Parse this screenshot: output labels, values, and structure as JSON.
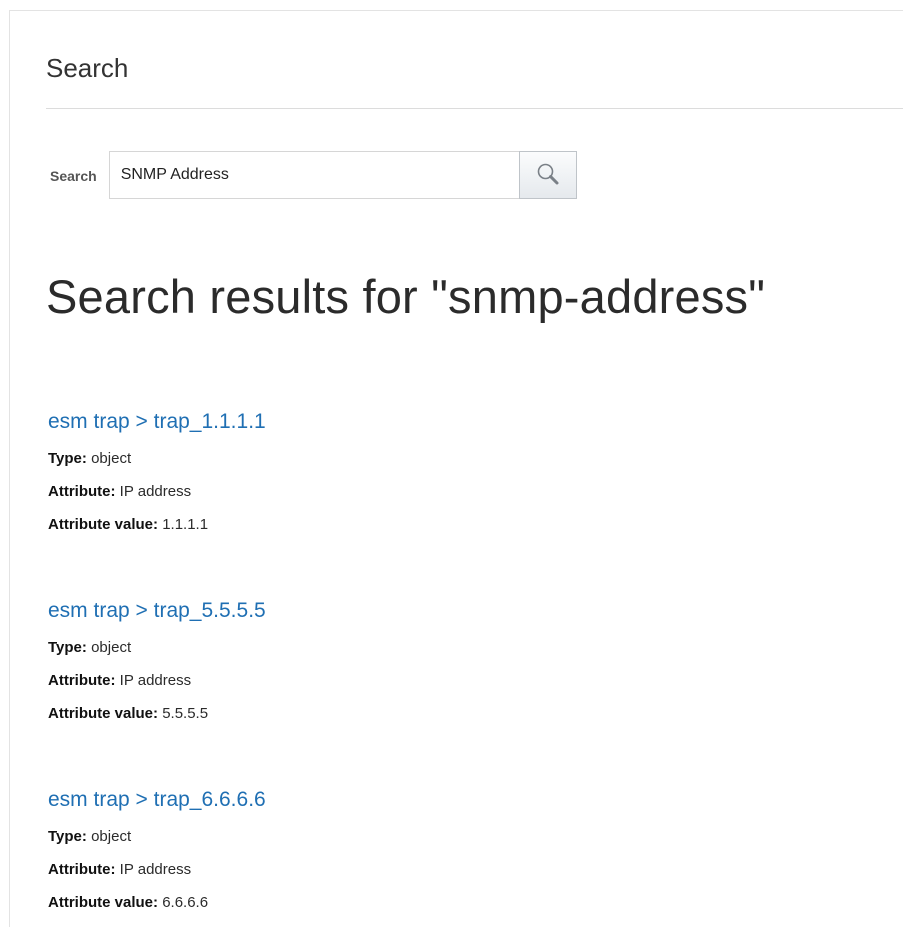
{
  "panel": {
    "title": "Search"
  },
  "search": {
    "label": "Search",
    "value": "SNMP Address",
    "button_icon": "search-icon"
  },
  "results": {
    "heading": "Search results for \"snmp-address\"",
    "items": [
      {
        "link": "esm trap > trap_1.1.1.1",
        "type_label": "Type:",
        "type_value": "object",
        "attribute_label": "Attribute:",
        "attribute_value": "IP address",
        "attr_value_label": "Attribute value:",
        "attr_value_value": "1.1.1.1"
      },
      {
        "link": "esm trap > trap_5.5.5.5",
        "type_label": "Type:",
        "type_value": "object",
        "attribute_label": "Attribute:",
        "attribute_value": "IP address",
        "attr_value_label": "Attribute value:",
        "attr_value_value": "5.5.5.5"
      },
      {
        "link": "esm trap > trap_6.6.6.6",
        "type_label": "Type:",
        "type_value": "object",
        "attribute_label": "Attribute:",
        "attribute_value": "IP address",
        "attr_value_label": "Attribute value:",
        "attr_value_value": "6.6.6.6"
      }
    ]
  },
  "colors": {
    "link": "#1f6fb3",
    "text": "#333333",
    "divider": "#dcdcdc"
  }
}
